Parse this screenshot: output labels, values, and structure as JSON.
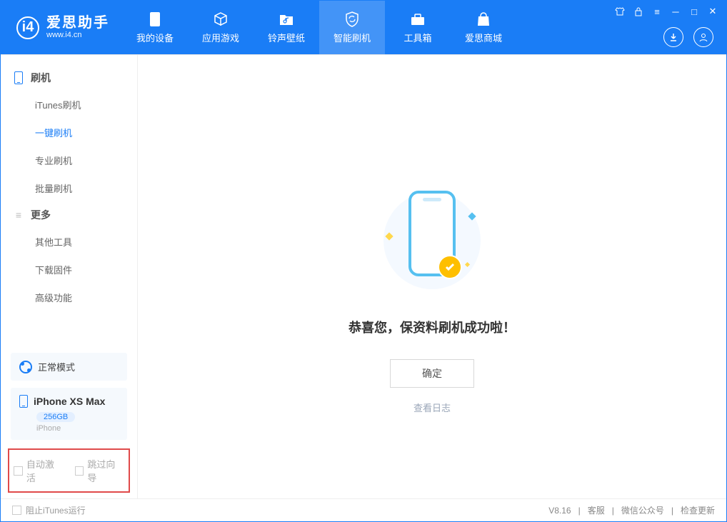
{
  "app": {
    "title": "爱思助手",
    "subtitle": "www.i4.cn"
  },
  "tabs": {
    "device": "我的设备",
    "apps": "应用游戏",
    "ringtone": "铃声壁纸",
    "flash": "智能刷机",
    "tools": "工具箱",
    "store": "爱思商城"
  },
  "sidebar": {
    "group_flash": "刷机",
    "items_flash": [
      "iTunes刷机",
      "一键刷机",
      "专业刷机",
      "批量刷机"
    ],
    "group_more": "更多",
    "items_more": [
      "其他工具",
      "下载固件",
      "高级功能"
    ]
  },
  "mode_panel": {
    "label": "正常模式"
  },
  "device_panel": {
    "name": "iPhone XS Max",
    "capacity": "256GB",
    "subtype": "iPhone"
  },
  "options": {
    "auto_activate": "自动激活",
    "skip_guide": "跳过向导"
  },
  "result": {
    "message": "恭喜您，保资料刷机成功啦！",
    "ok": "确定",
    "view_log": "查看日志"
  },
  "footer": {
    "block_itunes": "阻止iTunes运行",
    "version": "V8.16",
    "support": "客服",
    "wechat": "微信公众号",
    "update": "检查更新"
  }
}
